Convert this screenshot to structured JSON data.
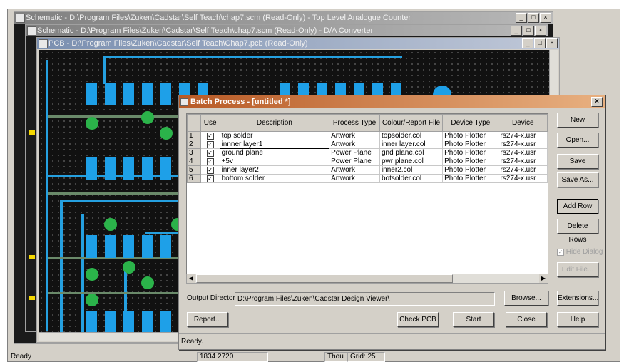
{
  "windows": {
    "schematic1": {
      "title": "Schematic - D:\\Program Files\\Zuken\\Cadstar\\Self Teach\\chap7.scm (Read-Only) - Top Level Analogue Counter"
    },
    "schematic2": {
      "title": "Schematic - D:\\Program Files\\Zuken\\Cadstar\\Self Teach\\chap7.scm (Read-Only) - D/A Converter"
    },
    "pcb": {
      "title": "PCB - D:\\Program Files\\Zuken\\Cadstar\\Self Teach\\Chap7.pcb (Read-Only)"
    },
    "window_buttons": {
      "minimize": "_",
      "maximize": "□",
      "close": "×"
    }
  },
  "dialog": {
    "title": "Batch Process - [untitled *]",
    "close": "×",
    "table": {
      "headers": [
        "",
        "Use",
        "Description",
        "Process Type",
        "Colour/Report File",
        "Device Type",
        "Device"
      ],
      "rows": [
        {
          "n": "1",
          "use": "✓",
          "description": "top solder",
          "process": "Artwork",
          "file": "topsolder.col",
          "device_type": "Photo Plotter",
          "device": "rs274-x.usr"
        },
        {
          "n": "2",
          "use": "✓",
          "description": "innner layer1",
          "process": "Artwork",
          "file": "inner layer.col",
          "device_type": "Photo Plotter",
          "device": "rs274-x.usr"
        },
        {
          "n": "3",
          "use": "✓",
          "description": "ground plane",
          "process": "Power Plane",
          "file": "gnd plane.col",
          "device_type": "Photo Plotter",
          "device": "rs274-x.usr"
        },
        {
          "n": "4",
          "use": "✓",
          "description": "+5v",
          "process": "Power Plane",
          "file": "pwr plane.col",
          "device_type": "Photo Plotter",
          "device": "rs274-x.usr"
        },
        {
          "n": "5",
          "use": "✓",
          "description": "inner layer2",
          "process": "Artwork",
          "file": "inner2.col",
          "device_type": "Photo Plotter",
          "device": "rs274-x.usr"
        },
        {
          "n": "6",
          "use": "✓",
          "description": "bottom solder",
          "process": "Artwork",
          "file": "botsolder.col",
          "device_type": "Photo Plotter",
          "device": "rs274-x.usr"
        }
      ]
    },
    "buttons": {
      "new": "New",
      "open": "Open...",
      "save": "Save",
      "save_as": "Save As...",
      "add_row": "Add Row",
      "delete_rows": "Delete Rows",
      "hide_dialog": "Hide Dialog",
      "edit_file": "Edit File...",
      "browse": "Browse...",
      "extensions": "Extensions...",
      "report": "Report...",
      "check_pcb": "Check PCB",
      "start": "Start",
      "close": "Close",
      "help": "Help"
    },
    "output_directory": {
      "label": "Output Directory:",
      "value": "D:\\Program Files\\Zuken\\Cadstar Design Viewer\\"
    },
    "status": "Ready."
  },
  "statusbar": {
    "left": "Ready",
    "coords": "1834  2720",
    "units": "Thou",
    "grid": "Grid: 25"
  },
  "colors": {
    "pad": "#1ea0e8",
    "via": "#2bb34a",
    "dialog_title": "#b85a26"
  }
}
